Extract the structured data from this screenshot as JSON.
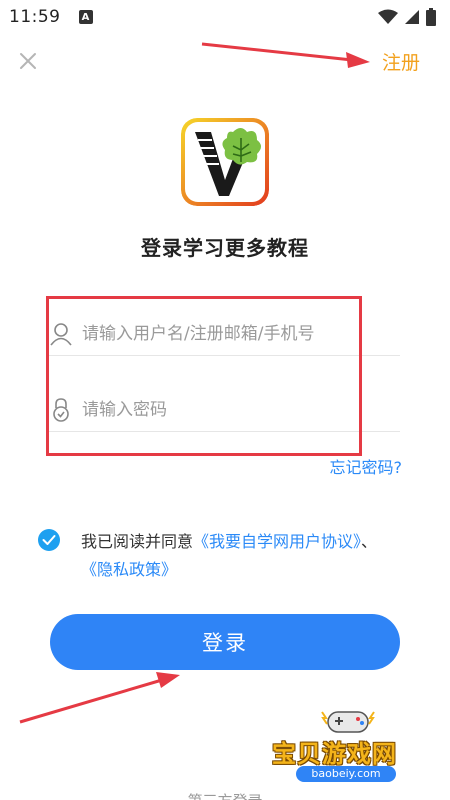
{
  "status_bar": {
    "time": "11:59",
    "notification_badge": "A"
  },
  "header": {
    "register_label": "注册"
  },
  "main": {
    "title": "登录学习更多教程",
    "username_placeholder": "请输入用户名/注册邮箱/手机号",
    "password_placeholder": "请输入密码",
    "forgot_label": "忘记密码?",
    "agreement": {
      "prefix": "我已阅读并同意",
      "user_agreement": "《我要自学网用户协议》",
      "separator": "、",
      "privacy_policy": "《隐私政策》"
    },
    "login_label": "登录",
    "third_party_label": "第三方登录"
  },
  "watermark": {
    "name": "宝贝游戏网",
    "domain": "baobeiy.com"
  },
  "colors": {
    "primary": "#2f84f6",
    "register": "#f2a11e",
    "link": "#2b8af7",
    "checkbox": "#1ea0f0",
    "annotation": "#e53a44"
  }
}
